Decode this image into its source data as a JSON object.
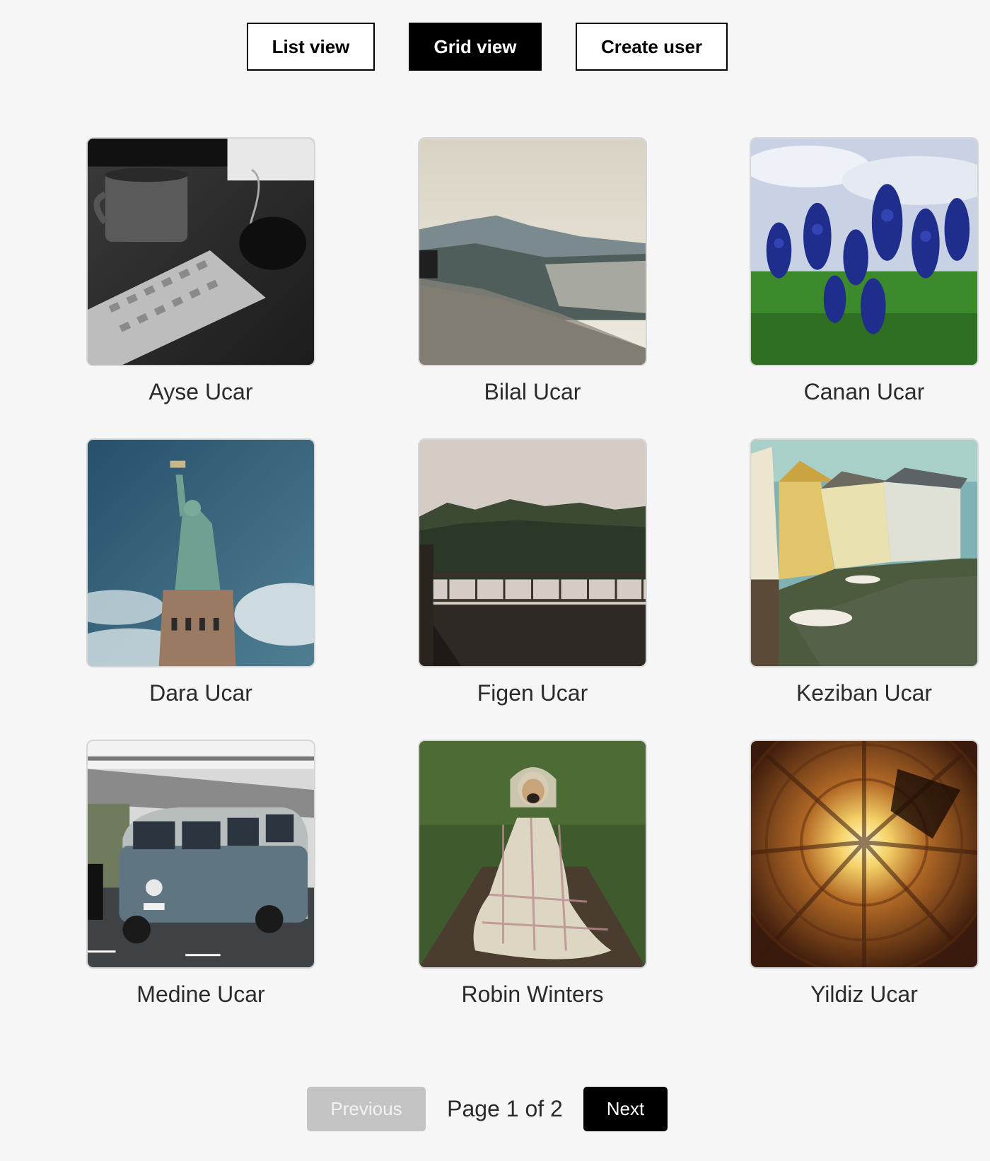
{
  "toolbar": {
    "list_view_label": "List view",
    "grid_view_label": "Grid view",
    "create_user_label": "Create user",
    "active_view": "grid"
  },
  "users": [
    {
      "name": "Ayse Ucar",
      "photo": "black-and-white keyboard and coffee mug"
    },
    {
      "name": "Bilal Ucar",
      "photo": "mountain valley view over stone wall"
    },
    {
      "name": "Canan Ucar",
      "photo": "blue lupine flowers under cloudy sky"
    },
    {
      "name": "Dara Ucar",
      "photo": "statue of liberty against sky"
    },
    {
      "name": "Figen Ucar",
      "photo": "foggy forest and wooden deck"
    },
    {
      "name": "Keziban Ucar",
      "photo": "canal with boats and old houses"
    },
    {
      "name": "Medine Ucar",
      "photo": "vintage blue van on road"
    },
    {
      "name": "Robin Winters",
      "photo": "pug wrapped in plaid blanket"
    },
    {
      "name": "Yildiz Ucar",
      "photo": "looking up at round courtyard towards sun"
    }
  ],
  "pagination": {
    "previous_label": "Previous",
    "page_text": "Page 1 of 2",
    "next_label": "Next",
    "current_page": 1,
    "total_pages": 2
  },
  "colors": {
    "background": "#f6f6f6",
    "primary": "#000000",
    "disabled": "#c4c4c4",
    "text": "#2b2b2b"
  }
}
